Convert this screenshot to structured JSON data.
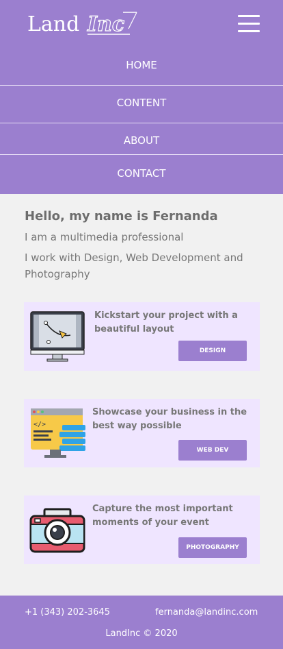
{
  "header": {
    "logo_text": "LandInc",
    "menu_icon": "hamburger-icon"
  },
  "nav": {
    "items": [
      {
        "label": "HOME"
      },
      {
        "label": "CONTENT"
      },
      {
        "label": "ABOUT"
      },
      {
        "label": "CONTACT"
      }
    ]
  },
  "intro": {
    "title": "Hello, my name is Fernanda",
    "line1": "I am a multimedia professional",
    "line2": "I work with Design, Web Development and Photography"
  },
  "cards": [
    {
      "icon": "design-monitor-icon",
      "text": "Kickstart your project with a beautiful layout",
      "button": "DESIGN"
    },
    {
      "icon": "code-monitor-icon",
      "text": "Showcase your business in the best way possible",
      "button": "WEB DEV"
    },
    {
      "icon": "camera-icon",
      "text": "Capture the most important moments of your event",
      "button": "PHOTOGRAPHY"
    }
  ],
  "footer": {
    "phone": "+1 (343) 202-3645",
    "email": "fernanda@landinc.com",
    "copyright": "LandInc © 2020"
  },
  "colors": {
    "brand": "#9b7fcf",
    "card_bg": "#efe5ff",
    "page_bg": "#f1f1f1"
  }
}
